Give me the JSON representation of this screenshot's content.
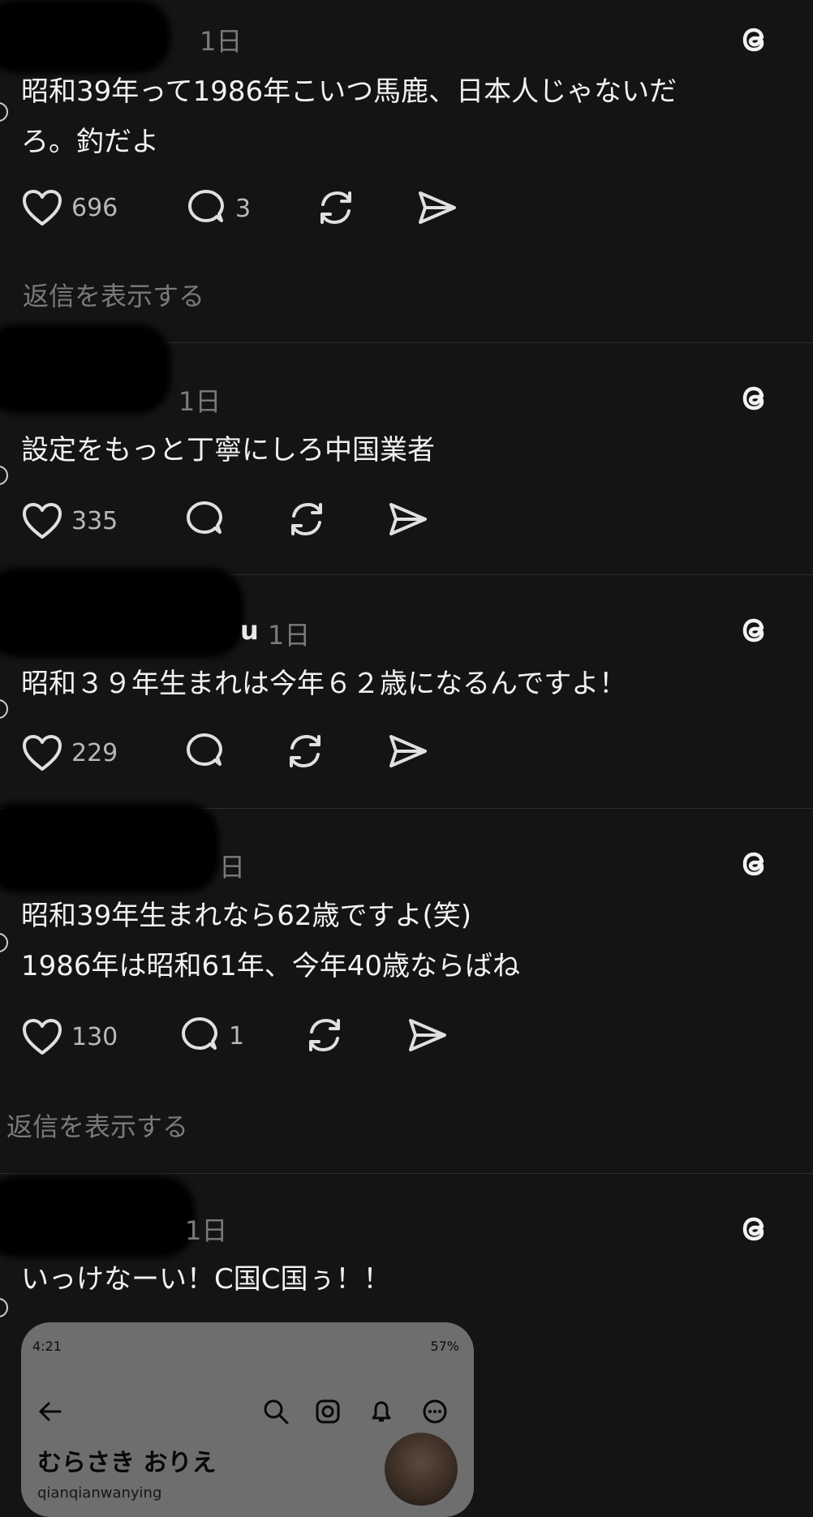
{
  "posts": [
    {
      "handle_fragment": "",
      "time": "1日",
      "text": "昭和39年って1986年こいつ馬鹿、日本人じゃないだ\nろ。釣だよ",
      "likes": "696",
      "replies": "3",
      "show_replies": "返信を表示する"
    },
    {
      "handle_fragment": "",
      "time": "1日",
      "text": "設定をもっと丁寧にしろ中国業者",
      "likes": "335",
      "replies": "",
      "show_replies": ""
    },
    {
      "handle_fragment": "u",
      "time": "1日",
      "text": "昭和３９年生まれは今年６２歳になるんですよ！",
      "likes": "229",
      "replies": "",
      "show_replies": ""
    },
    {
      "handle_fragment": "",
      "time": "日",
      "text": "昭和39年生まれなら62歳ですよ(笑)\n1986年は昭和61年、今年40歳ならばね",
      "likes": "130",
      "replies": "1",
      "show_replies": "返信を表示する"
    },
    {
      "handle_fragment": "",
      "time": "1日",
      "text": "いっけなーい！C国C国ぅ！！",
      "likes": "",
      "replies": "",
      "show_replies": ""
    }
  ],
  "embed": {
    "status_time": "4:21",
    "battery": "57%",
    "profile_name": "むらさき おりえ",
    "username": "qianqianwanying"
  },
  "icons": {
    "threads": "threads-logo-icon",
    "like": "heart-icon",
    "reply": "comment-icon",
    "repost": "repost-icon",
    "share": "send-icon"
  },
  "colors": {
    "background": "#141414",
    "text": "#f2f2f2",
    "muted": "#7a7a7a",
    "divider": "#2e2e2e"
  }
}
